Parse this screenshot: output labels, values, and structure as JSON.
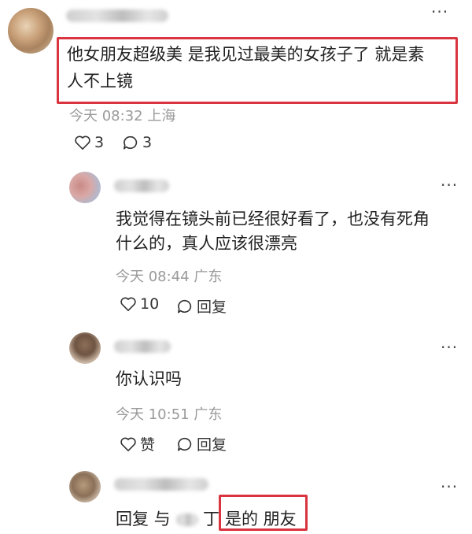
{
  "comments": [
    {
      "text_line1": "他女朋友超级美 是我见过最美的女孩子了 就是素",
      "text_line2": "人不上镜",
      "time": "今天 08:32 上海",
      "likes": "3",
      "replies": "3"
    }
  ],
  "replies": [
    {
      "text_line1": "我觉得在镜头前已经很好看了，也没有死角",
      "text_line2": "什么的，真人应该很漂亮",
      "time": "今天 08:44 广东",
      "likes": "10",
      "reply_label": "回复"
    },
    {
      "text_line1": "你认识吗",
      "time": "今天 10:51 广东",
      "likes": "赞",
      "reply_label": "回复"
    },
    {
      "prefix": "回复 与",
      "suffix": "丁",
      "text": "是的 朋友"
    }
  ],
  "icons": {
    "heart": "heart-icon",
    "comment": "comment-icon",
    "more": "more-icon"
  },
  "colors": {
    "highlight": "#d9343f",
    "meta": "#9a9a9a"
  }
}
